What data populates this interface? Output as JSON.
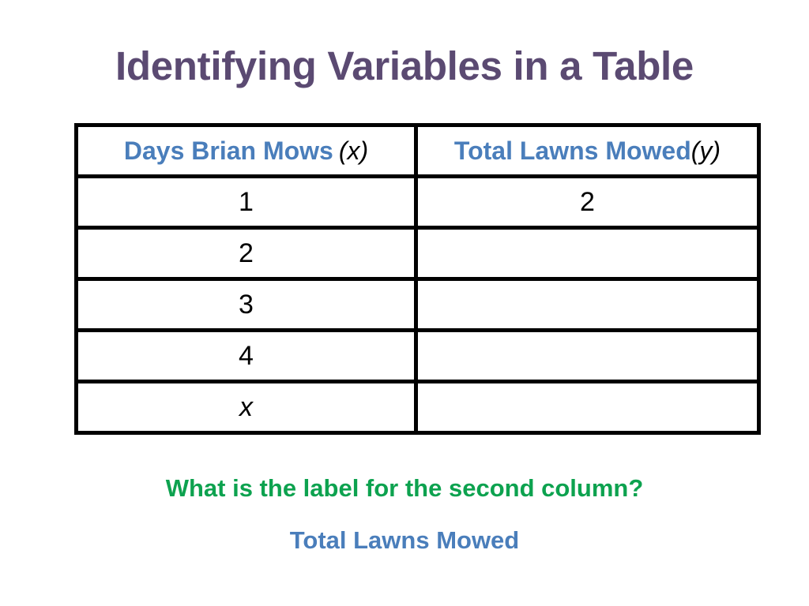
{
  "slide": {
    "title": "Identifying Variables in a Table",
    "title_color": "#5B4A72",
    "background_color": "#ffffff"
  },
  "table": {
    "border_color": "#000000",
    "label_color": "#4A7EBB",
    "headers": [
      {
        "label": "Days Brian Mows",
        "variable": "(x)"
      },
      {
        "label": "Total Lawns Mowed",
        "variable": "(y)"
      }
    ],
    "rows": [
      {
        "col1": "1",
        "col2": "2"
      },
      {
        "col1": "2",
        "col2": ""
      },
      {
        "col1": "3",
        "col2": ""
      },
      {
        "col1": "4",
        "col2": ""
      },
      {
        "col1": "x",
        "col2": ""
      }
    ]
  },
  "question": {
    "text": "What is the label for the second column?",
    "color": "#0DA24F"
  },
  "answer": {
    "text": "Total Lawns Mowed",
    "color": "#4A7EBB"
  }
}
